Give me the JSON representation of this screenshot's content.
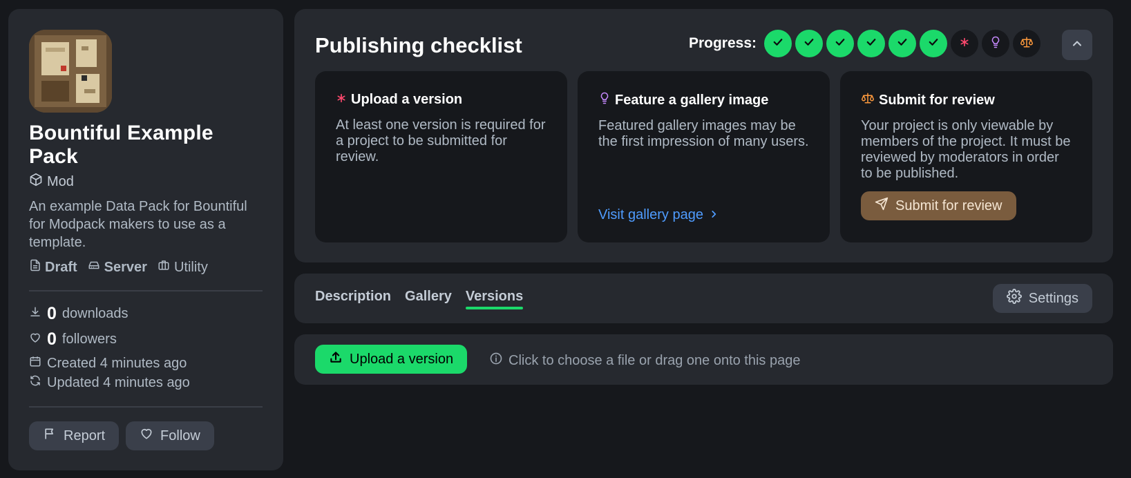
{
  "project": {
    "title": "Bountiful Example Pack",
    "type": "Mod",
    "description": "An example Data Pack for Bountiful for Modpack makers to use as a template.",
    "status": "Draft",
    "environment": "Server",
    "category": "Utility",
    "downloads_count": "0",
    "downloads_label": "downloads",
    "followers_count": "0",
    "followers_label": "followers",
    "created": "Created 4 minutes ago",
    "updated": "Updated 4 minutes ago",
    "report_label": "Report",
    "follow_label": "Follow"
  },
  "checklist": {
    "title": "Publishing checklist",
    "progress_label": "Progress:",
    "progress_steps": [
      {
        "state": "done",
        "icon": "check-icon"
      },
      {
        "state": "done",
        "icon": "check-icon"
      },
      {
        "state": "done",
        "icon": "check-icon"
      },
      {
        "state": "done",
        "icon": "check-icon"
      },
      {
        "state": "done",
        "icon": "check-icon"
      },
      {
        "state": "done",
        "icon": "check-icon"
      },
      {
        "state": "required",
        "icon": "asterisk-icon"
      },
      {
        "state": "suggestion",
        "icon": "lightbulb-icon"
      },
      {
        "state": "review",
        "icon": "scale-icon"
      }
    ],
    "tasks": [
      {
        "title": "Upload a version",
        "body": "At least one version is required for a project to be submitted for review.",
        "icon": "asterisk-icon",
        "icon_color": "#ff496e"
      },
      {
        "title": "Feature a gallery image",
        "body": "Featured gallery images may be the first impression of many users.",
        "link": "Visit gallery page",
        "icon": "lightbulb-icon",
        "icon_color": "#c78aff"
      },
      {
        "title": "Submit for review",
        "body": "Your project is only viewable by members of the project. It must be reviewed by moderators in order to be published.",
        "button": "Submit for review",
        "icon": "scale-icon",
        "icon_color": "#ff9a3d"
      }
    ]
  },
  "tabs": {
    "items": [
      "Description",
      "Gallery",
      "Versions"
    ],
    "active": "Versions",
    "settings_label": "Settings"
  },
  "upload": {
    "button_label": "Upload a version",
    "hint": "Click to choose a file or drag one onto this page"
  },
  "colors": {
    "brand_green": "#1bd96a",
    "link_blue": "#4f9cff",
    "background": "#16181c",
    "card": "#26292f"
  }
}
